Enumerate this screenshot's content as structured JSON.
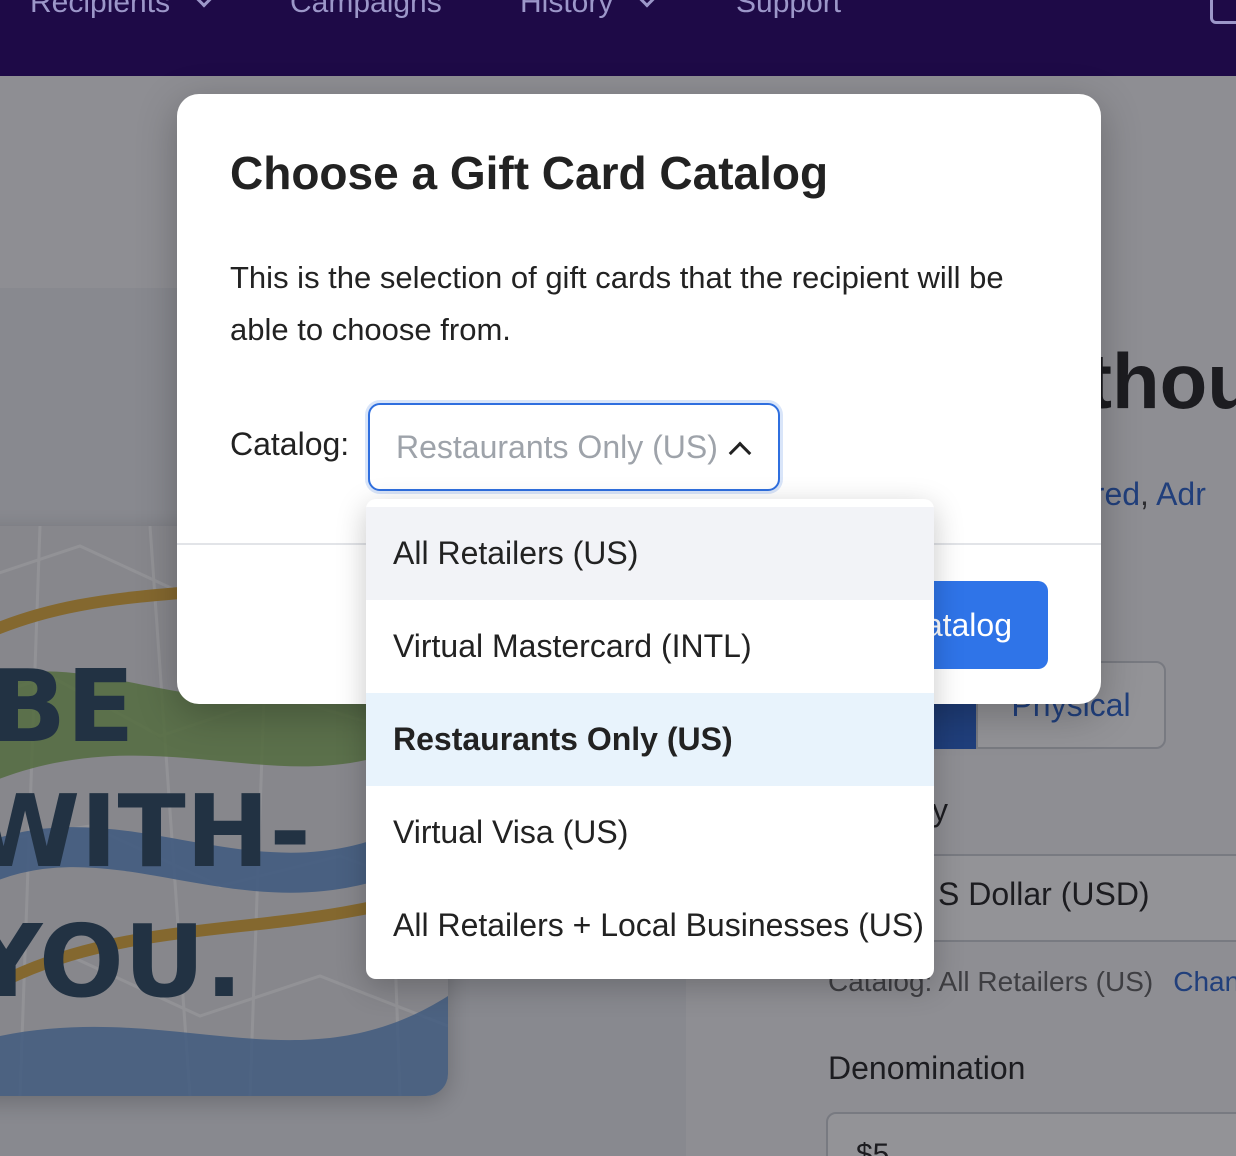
{
  "nav": {
    "items": [
      {
        "label": "Recipients",
        "has_chevron": true
      },
      {
        "label": "Campaigns",
        "has_chevron": false
      },
      {
        "label": "History",
        "has_chevron": true
      },
      {
        "label": "Support",
        "has_chevron": false
      }
    ]
  },
  "background": {
    "title_fragment": "thou",
    "links": {
      "first": "ured",
      "separator": ",",
      "second": "Adr"
    },
    "format_option": "Physical",
    "currency_label": "cy",
    "currency_value": "S Dollar (USD)",
    "catalog_line": "Catalog: All Retailers (US)",
    "change_link": "Chang",
    "denomination_label": "Denomination",
    "denomination_value": "$5",
    "gift_card_text": [
      "BE",
      "WITH-",
      "YOU."
    ]
  },
  "modal": {
    "title": "Choose a Gift Card Catalog",
    "description": "This is the selection of gift cards that the recipient will be able to choose from.",
    "catalog_label": "Catalog:",
    "selected_value": "Restaurants Only (US)",
    "button_label_visible": "atalog"
  },
  "dropdown": {
    "options": [
      {
        "label": "All Retailers (US)",
        "state": "hover"
      },
      {
        "label": "Virtual Mastercard (INTL)",
        "state": "normal"
      },
      {
        "label": "Restaurants Only (US)",
        "state": "selected"
      },
      {
        "label": "Virtual Visa (US)",
        "state": "normal"
      },
      {
        "label": "All Retailers + Local Businesses (US)",
        "state": "normal"
      }
    ]
  },
  "colors": {
    "nav_bg": "#1e0a47",
    "primary": "#2f74e8",
    "selected_option_bg": "#e8f3fc",
    "hover_option_bg": "#f2f3f7"
  }
}
